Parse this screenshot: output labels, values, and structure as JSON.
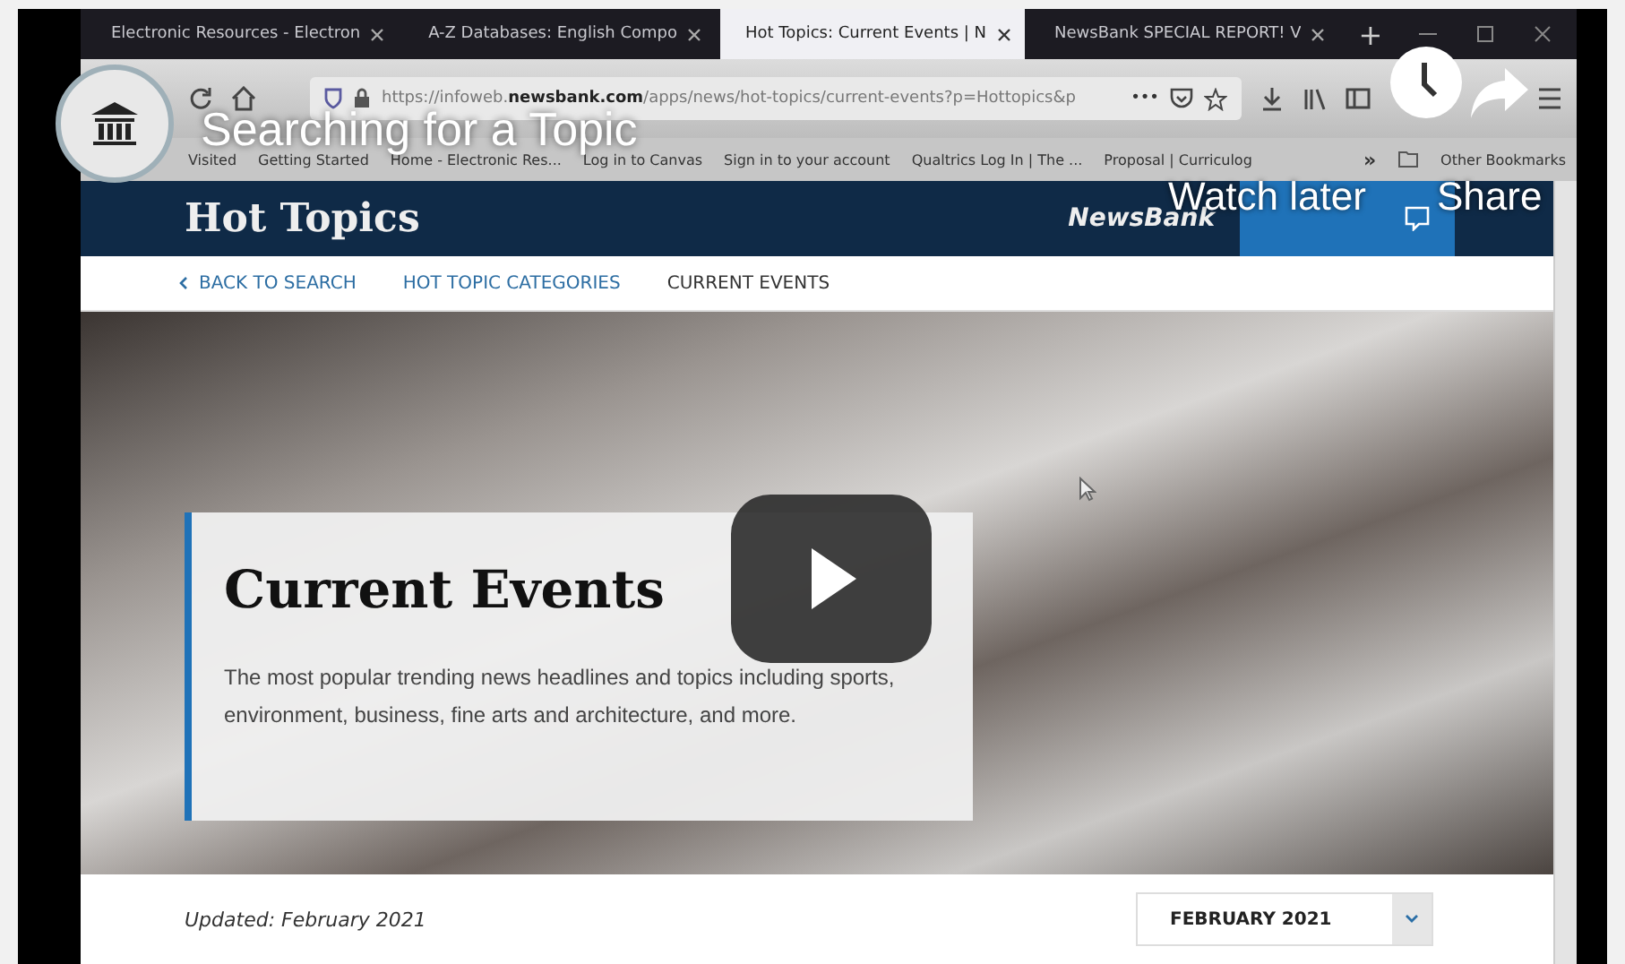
{
  "video": {
    "title": "Searching for a Topic",
    "watch_later": "Watch later",
    "share": "Share"
  },
  "browser": {
    "tabs": [
      {
        "label": "Electronic Resources - Electron",
        "selected": false
      },
      {
        "label": "A-Z Databases: English Compo",
        "selected": false
      },
      {
        "label": "Hot Topics: Current Events | N",
        "selected": true
      },
      {
        "label": "NewsBank SPECIAL REPORT! V",
        "selected": false
      }
    ],
    "new_tab": "+",
    "url": "https://infoweb.**newsbank.com**/apps/news/hot-topics/current-events?p=Hottopics&p",
    "page_actions": "•••",
    "bookmarks": [
      "Visited",
      "Getting Started",
      "Home - Electronic Res...",
      "Log in to Canvas",
      "Sign in to your account",
      "Qualtrics Log In | The ...",
      "Proposal | Curriculog"
    ],
    "more_bookmarks": "»",
    "other_bookmarks": "Other Bookmarks"
  },
  "site": {
    "title": "Hot Topics",
    "brand": "NewsBank",
    "breadcrumbs": [
      {
        "label": "BACK TO SEARCH",
        "kind": "back"
      },
      {
        "label": "HOT TOPIC CATEGORIES",
        "kind": "link"
      },
      {
        "label": "CURRENT EVENTS",
        "kind": "current"
      }
    ],
    "hero": {
      "title": "Current Events",
      "description": "The most popular trending news headlines and topics including sports, environment, business, fine arts and architecture, and more."
    },
    "updated": "Updated: February 2021",
    "month_select": {
      "value": "FEBRUARY 2021"
    }
  }
}
